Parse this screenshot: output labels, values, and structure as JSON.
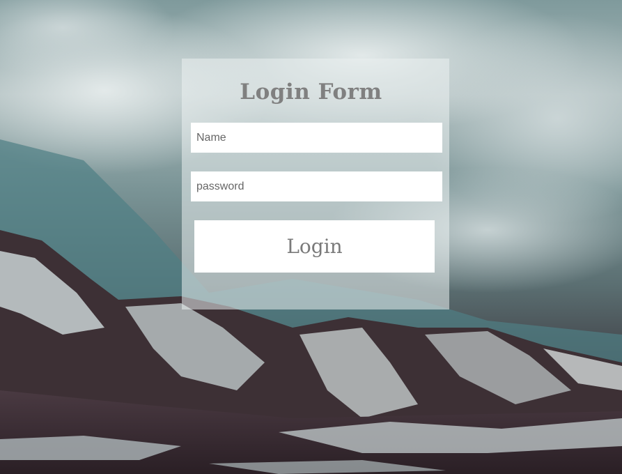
{
  "form": {
    "title": "Login Form",
    "name_placeholder": "Name",
    "password_placeholder": "password",
    "login_label": "Login"
  },
  "colors": {
    "title": "#808080",
    "card_overlay": "rgba(235,240,241,0.55)",
    "button_bg": "#ffffff",
    "button_text": "#7a7a7a"
  }
}
